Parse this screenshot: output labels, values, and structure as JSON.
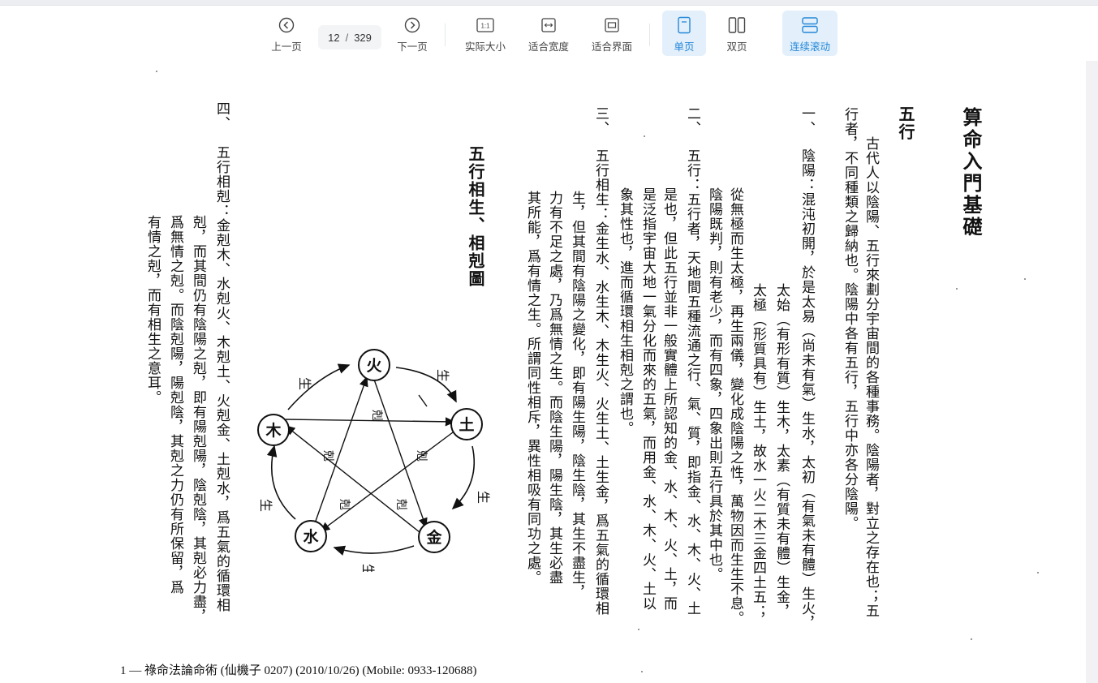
{
  "toolbar": {
    "prev_label": "上一页",
    "page_current": "12",
    "page_total": "329",
    "next_label": "下一页",
    "actual_size_label": "实际大小",
    "fit_width_label": "适合宽度",
    "fit_page_label": "适合界面",
    "single_label": "单页",
    "double_label": "双页",
    "continuous_label": "连续滚动",
    "actual_size_icon_text": "1:1",
    "accent_color": "#2386d8"
  },
  "document": {
    "header": "算命入門基礎",
    "section_title": "五行",
    "intro_line1": "古代人以陰陽、五行來劃分宇宙間的各種事務。陰陽者，對立之存在也；五",
    "intro_line2": "行者，不同種類之歸納也。陰陽中各有五行，五行中亦各分陰陽。",
    "item1_mark": "一、",
    "item1_line1": "陰陽：混沌初開，於是太易（尚未有氣）生水，太初（有氣未有體）生火，",
    "item1_line2": "太始（有形有質）生木，太素（有質未有體）生金，",
    "item1_line3": "太極（形質具有）生土，故水一火二木三金四土五；",
    "item1_line4": "從無極而生太極，再生兩儀，變化成陰陽之性，萬物因而生生不息。",
    "item1_line5": "陰陽既判，則有老少，而有四象，四象出則五行具於其中也。",
    "item2_mark": "二、",
    "item2_line1": "五行：五行者，天地間五種流通之行、氣、質，即指金、水、木、火、土",
    "item2_line2": "是也，但此五行並非一般實體上所認知的金、水、木、火、土，而",
    "item2_line3": "是泛指宇宙大地一氣分化而來的五氣，而用金、水、木、火、土以",
    "item2_line4": "象其性也，進而循環相生相剋之謂也。",
    "item3_mark": "三、",
    "item3_line1": "五行相生：金生水、水生木、木生火、火生土、土生金，爲五氣的循環相",
    "item3_line2": "生，但其間有陰陽之變化，即有陽生陽，陰生陰，其生不盡生，",
    "item3_line3": "力有不足之處，乃爲無情之生。而陰生陽，陽生陰，其生必盡",
    "item3_line4": "其所能，爲有情之生。所謂同性相斥，異性相吸有同功之處。",
    "diagram_title": "五行相生、相剋圖",
    "item4_mark": "四、",
    "item4_line1": "五行相剋：金剋木、水剋火、木剋土、火剋金、土剋水，爲五氣的循環相",
    "item4_line2": "剋，而其間仍有陰陽之剋，即有陽剋陽，陰剋陰，其剋必力盡，",
    "item4_line3": "爲無情之剋。而陰剋陽，陽剋陰，其剋之力仍有所保留，爲",
    "item4_line4": "有情之剋，而有相生之意耳。",
    "footer": "1 — 祿命法論命術 (仙機子 0207) (2010/10/26) (Mobile: 0933-120688)"
  },
  "diagram": {
    "node_fire": "火",
    "node_earth": "土",
    "node_metal": "金",
    "node_water": "水",
    "node_wood": "木",
    "sheng_label": "生",
    "ke_label": "剋"
  }
}
